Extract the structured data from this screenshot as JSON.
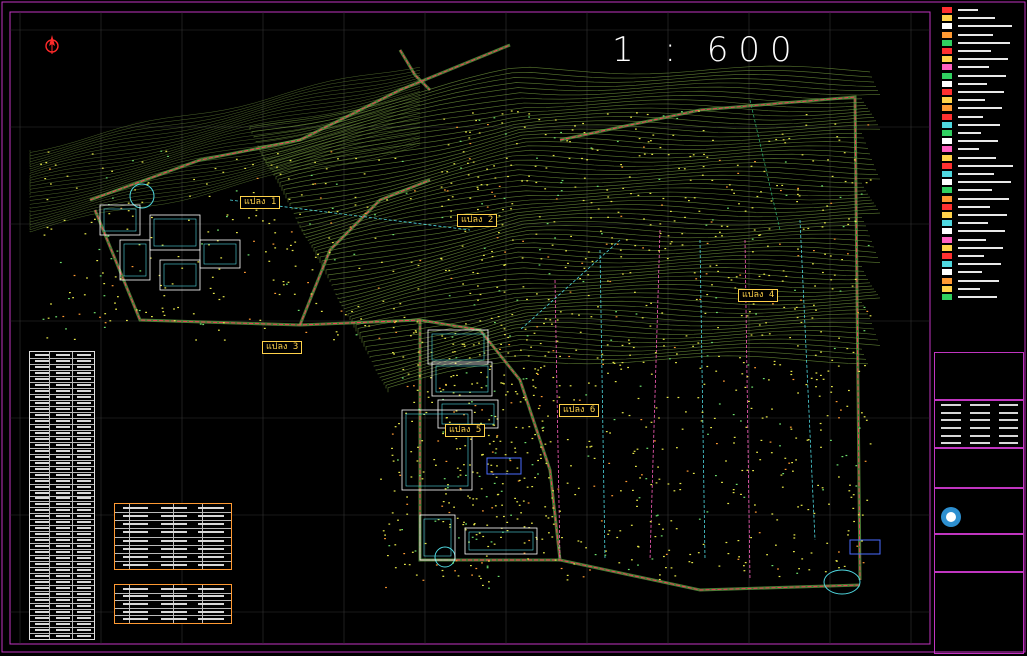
{
  "drawing": {
    "scale_text": "1 : 600",
    "north_arrow_icon": "north-arrow-icon",
    "zones": [
      {
        "id": "zone-1",
        "text": "แปลง 1"
      },
      {
        "id": "zone-2",
        "text": "แปลง 2"
      },
      {
        "id": "zone-3",
        "text": "แปลง 3"
      },
      {
        "id": "zone-4",
        "text": "แปลง 4"
      },
      {
        "id": "zone-5",
        "text": "แปลง 5"
      },
      {
        "id": "zone-6",
        "text": "แปลง 6"
      }
    ]
  },
  "colors": {
    "background": "#000000",
    "frame": "#c035c0",
    "contour_green": "#6b8f3a",
    "road_red": "#ff3b5c",
    "label_yellow": "#ffd24a",
    "water_cyan": "#4fd8e0",
    "tree_yellow": "#e8e84a"
  },
  "legend": {
    "swatch_colors": [
      "#ff3030",
      "#ffd24a",
      "#ffffff",
      "#ff9a33",
      "#30d060",
      "#ff3030",
      "#ffd24a",
      "#ff60c0",
      "#30d060",
      "#ffffff",
      "#ff3030",
      "#ffd24a",
      "#ff9a33",
      "#ff3030",
      "#4fd8e0",
      "#30d060",
      "#ffffff",
      "#ff60c0",
      "#ffd24a",
      "#ff3030",
      "#4fd8e0",
      "#ffffff",
      "#30d060",
      "#ff9a33",
      "#ff3030",
      "#ffd24a",
      "#4fd8e0",
      "#ffffff",
      "#ff60c0",
      "#ffd24a",
      "#ff3030",
      "#4fd8e0",
      "#ffffff",
      "#ff9a33",
      "#ffd24a",
      "#30d060"
    ]
  }
}
